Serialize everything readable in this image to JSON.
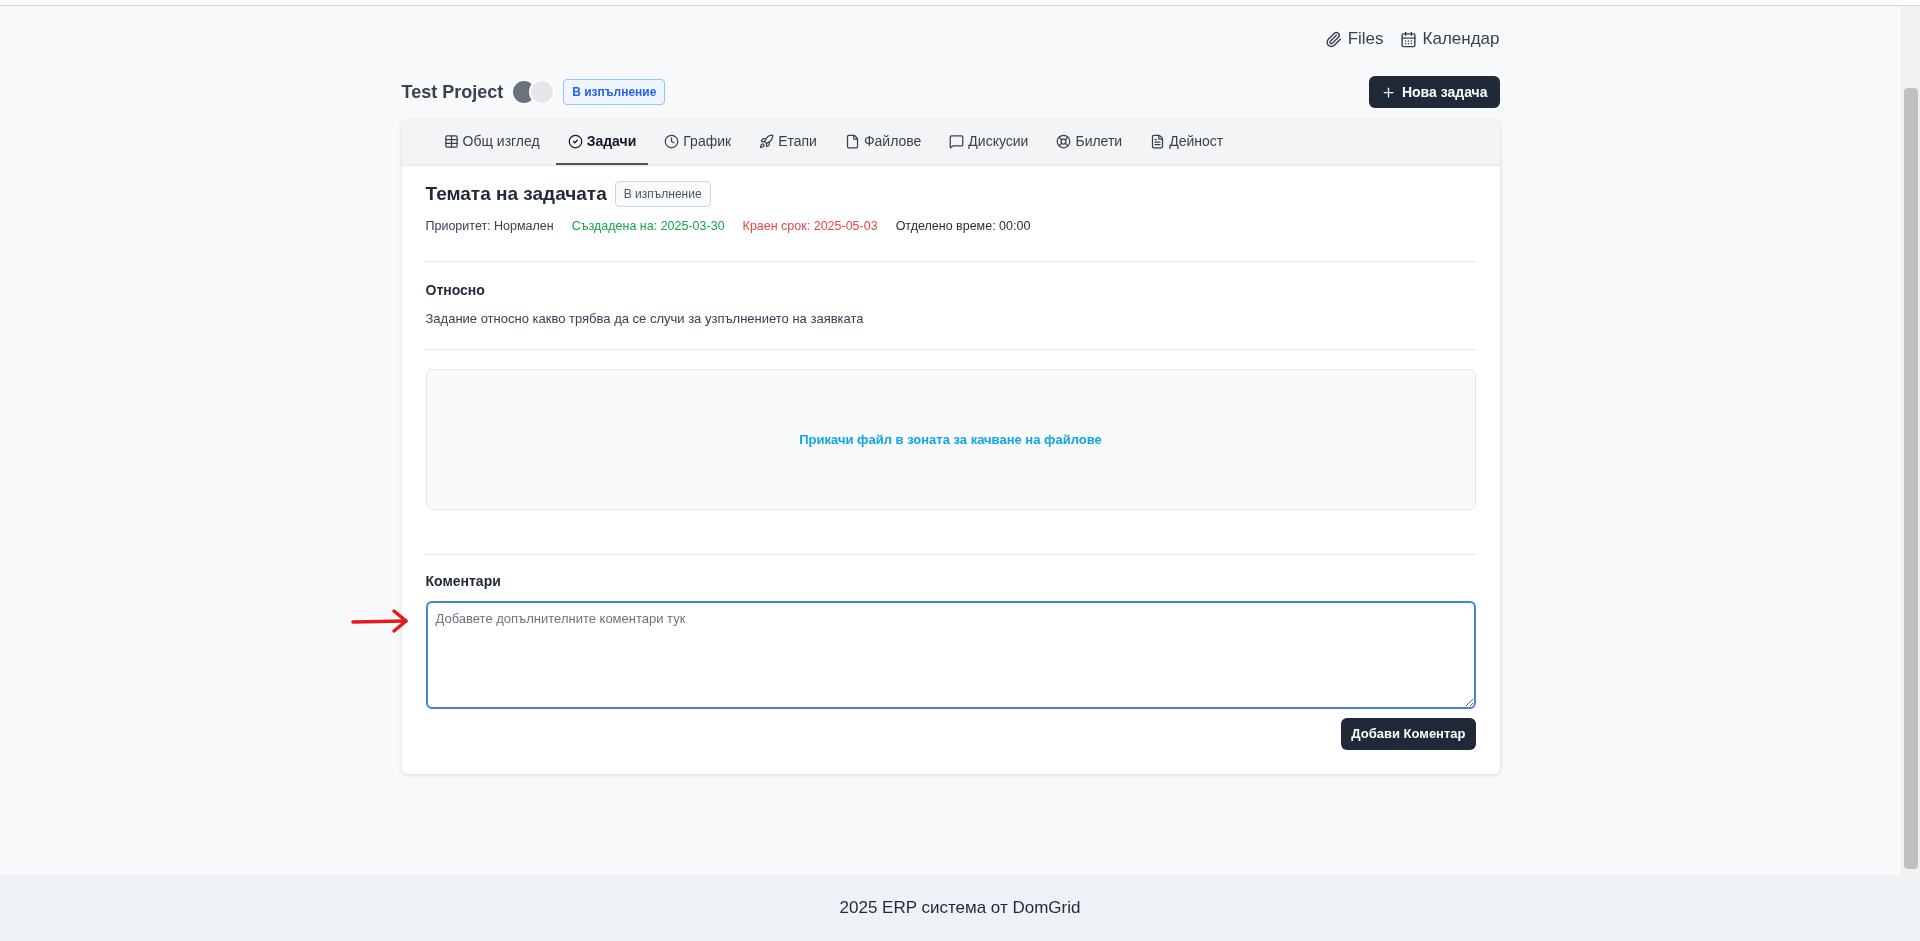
{
  "top_links": [
    {
      "kind": "files",
      "label": "Files"
    },
    {
      "kind": "calendar",
      "label": "Календар"
    }
  ],
  "project": {
    "title": "Test Project",
    "status": "В изпълнение",
    "new_task_button": "Нова задача"
  },
  "tabs": [
    {
      "kind": "table",
      "label": "Общ изглед",
      "selected": false
    },
    {
      "kind": "check",
      "label": "Задачи",
      "selected": true
    },
    {
      "kind": "clock",
      "label": "График",
      "selected": false
    },
    {
      "kind": "rocket",
      "label": "Етапи",
      "selected": false
    },
    {
      "kind": "file",
      "label": "Файлове",
      "selected": false
    },
    {
      "kind": "chat",
      "label": "Дискусии",
      "selected": false
    },
    {
      "kind": "lifebuoy",
      "label": "Билети",
      "selected": false
    },
    {
      "kind": "document",
      "label": "Дейност",
      "selected": false
    }
  ],
  "task": {
    "title": "Темата на задачата",
    "status": "В изпълнение",
    "meta": [
      {
        "text": "Приоритет: Нормален",
        "color": "#374151"
      },
      {
        "text": "Създадена на: 2025-03-30",
        "color": "#16a34a"
      },
      {
        "text": "Краен срок: 2025-05-03",
        "color": "#ef4444"
      },
      {
        "text": "Отделено време: 00:00",
        "color": "#1f2937"
      }
    ],
    "about_heading": "Относно",
    "about_text": "Задание относно какво трябва да се случи за узпълнението на заявката",
    "dropzone": "Прикачи файл в зоната за качване на файлове",
    "comments_heading": "Коментари",
    "comment_field": {
      "placeholder": "Добавете допълнителните коментари тук"
    },
    "add_comment_button": "Добави Коментар"
  },
  "footer": "2025 ERP система от DomGrid"
}
